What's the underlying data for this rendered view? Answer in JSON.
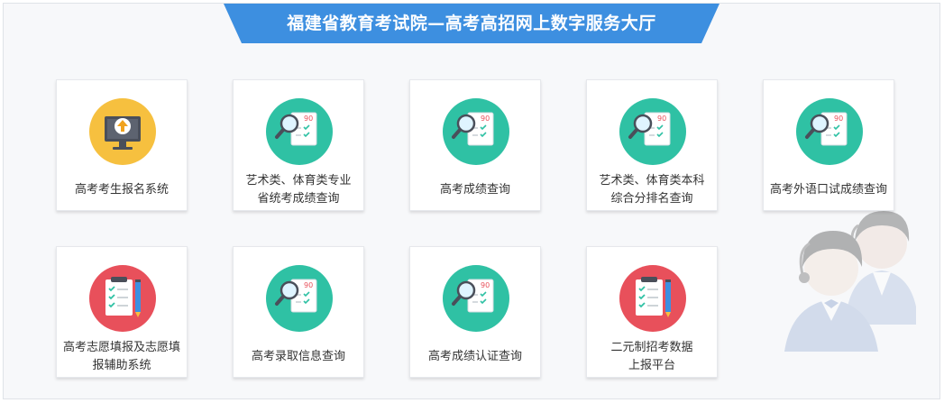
{
  "header": {
    "title": "福建省教育考试院—高考高招网上数字服务大厅"
  },
  "colors": {
    "banner": "#3d8fe0",
    "teal": "#2fc1a4",
    "gold": "#f6c03f",
    "red": "#e8505b"
  },
  "services": [
    {
      "lines": [
        "高考考生报名系统"
      ],
      "icon": "upload-monitor-icon"
    },
    {
      "lines": [
        "艺术类、体育类专业",
        "省统考成绩查询"
      ],
      "icon": "score-magnifier-icon"
    },
    {
      "lines": [
        "高考成绩查询"
      ],
      "icon": "score-magnifier-icon"
    },
    {
      "lines": [
        "艺术类、体育类本科",
        "综合分排名查询"
      ],
      "icon": "score-magnifier-icon"
    },
    {
      "lines": [
        "高考外语口试成绩查询"
      ],
      "icon": "score-magnifier-icon"
    },
    {
      "lines": [
        "高考志愿填报及志愿填",
        "报辅助系统"
      ],
      "icon": "checklist-pencil-icon"
    },
    {
      "lines": [
        "高考录取信息查询"
      ],
      "icon": "score-magnifier-icon"
    },
    {
      "lines": [
        "高考成绩认证查询"
      ],
      "icon": "score-magnifier-icon"
    },
    {
      "lines": [
        "二元制招考数据",
        "上报平台"
      ],
      "icon": "checklist-pencil-icon"
    }
  ],
  "score_badge": "90"
}
